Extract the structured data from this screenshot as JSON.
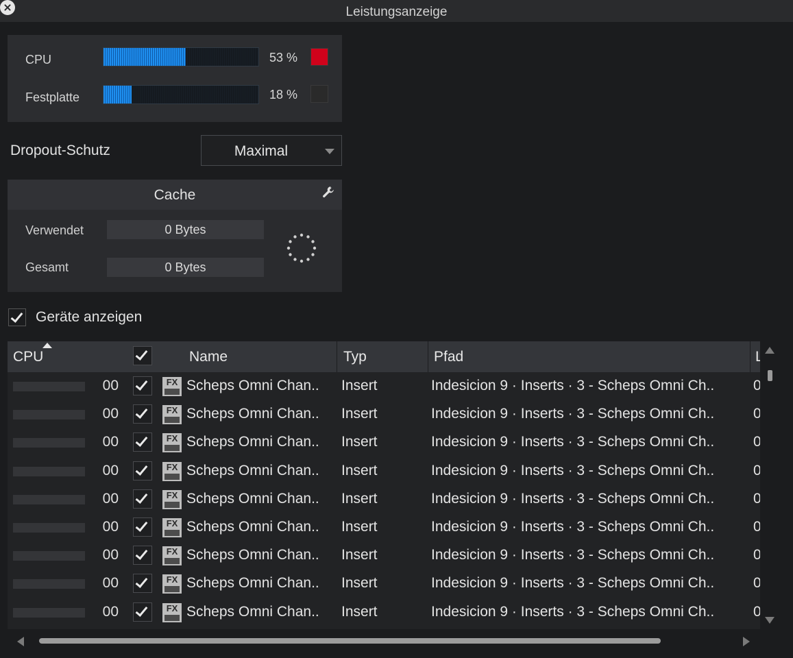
{
  "window": {
    "title": "Leistungsanzeige"
  },
  "meters": {
    "cpu": {
      "label": "CPU",
      "value_text": "53 %",
      "level": 0.53,
      "led_color": "#d0021b"
    },
    "disk": {
      "label": "Festplatte",
      "value_text": "18 %",
      "level": 0.18,
      "led_color": "#2a2a2a"
    }
  },
  "dropout": {
    "label": "Dropout-Schutz",
    "selected": "Maximal"
  },
  "cache": {
    "title": "Cache",
    "used_label": "Verwendet",
    "used_value": "0 Bytes",
    "total_label": "Gesamt",
    "total_value": "0 Bytes"
  },
  "show_devices": {
    "label": "Geräte anzeigen",
    "checked": true
  },
  "table": {
    "columns": {
      "cpu": "CPU",
      "name": "Name",
      "type": "Typ",
      "path": "Pfad",
      "extra": "L"
    },
    "rows": [
      {
        "cpu": "00",
        "enabled": true,
        "icon": "fx-plugin-icon",
        "name": "Scheps Omni Chan..",
        "type": "Insert",
        "path": "Indesicion 9 · Inserts · 3 - Scheps Omni Ch..",
        "extra": "0"
      },
      {
        "cpu": "00",
        "enabled": true,
        "icon": "fx-plugin-icon",
        "name": "Scheps Omni Chan..",
        "type": "Insert",
        "path": "Indesicion 9 · Inserts · 3 - Scheps Omni Ch..",
        "extra": "0"
      },
      {
        "cpu": "00",
        "enabled": true,
        "icon": "fx-plugin-icon",
        "name": "Scheps Omni Chan..",
        "type": "Insert",
        "path": "Indesicion 9 · Inserts · 3 - Scheps Omni Ch..",
        "extra": "0"
      },
      {
        "cpu": "00",
        "enabled": true,
        "icon": "fx-plugin-icon",
        "name": "Scheps Omni Chan..",
        "type": "Insert",
        "path": "Indesicion 9 · Inserts · 3 - Scheps Omni Ch..",
        "extra": "0"
      },
      {
        "cpu": "00",
        "enabled": true,
        "icon": "fx-plugin-icon",
        "name": "Scheps Omni Chan..",
        "type": "Insert",
        "path": "Indesicion 9 · Inserts · 3 - Scheps Omni Ch..",
        "extra": "0"
      },
      {
        "cpu": "00",
        "enabled": true,
        "icon": "fx-plugin-icon",
        "name": "Scheps Omni Chan..",
        "type": "Insert",
        "path": "Indesicion 9 · Inserts · 3 - Scheps Omni Ch..",
        "extra": "0"
      },
      {
        "cpu": "00",
        "enabled": true,
        "icon": "fx-plugin-icon",
        "name": "Scheps Omni Chan..",
        "type": "Insert",
        "path": "Indesicion 9 · Inserts · 3 - Scheps Omni Ch..",
        "extra": "0"
      },
      {
        "cpu": "00",
        "enabled": true,
        "icon": "fx-plugin-icon",
        "name": "Scheps Omni Chan..",
        "type": "Insert",
        "path": "Indesicion 9 · Inserts · 3 - Scheps Omni Ch..",
        "extra": "0"
      },
      {
        "cpu": "00",
        "enabled": true,
        "icon": "fx-plugin-icon",
        "name": "Scheps Omni Chan..",
        "type": "Insert",
        "path": "Indesicion 9 · Inserts · 3 - Scheps Omni Ch..",
        "extra": "0"
      }
    ]
  },
  "scroll": {
    "horizontal_position": 0.0,
    "vertical_position": 0.0
  }
}
